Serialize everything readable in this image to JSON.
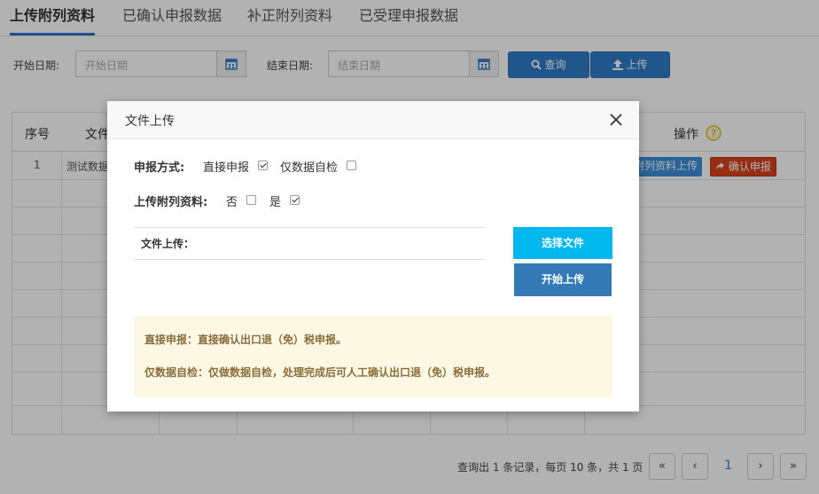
{
  "tabs": [
    "上传附列资料",
    "已确认申报数据",
    "补正附列资料",
    "已受理申报数据"
  ],
  "filter": {
    "start_label": "开始日期:",
    "start_placeholder": "开始日期",
    "end_label": "结束日期:",
    "end_placeholder": "结束日期",
    "query_button": "查询",
    "upload_button": "上传"
  },
  "table": {
    "headers": {
      "index": "序号",
      "file": "文件",
      "ops": "操作"
    },
    "row1": {
      "index": "1",
      "file": "测试数据"
    },
    "row_actions": {
      "attach_upload": "附列资料上传",
      "confirm": "确认申报"
    }
  },
  "pager": {
    "info": "查询出 1 条记录，每页 10 条，共 1 页",
    "first": "«",
    "prev": "‹",
    "current": "1",
    "next": "›",
    "last": "»"
  },
  "modal": {
    "title": "文件上传",
    "report_mode_label": "申报方式:",
    "direct_report": "直接申报",
    "direct_report_checked": true,
    "self_check_only": "仅数据自检",
    "self_check_only_checked": false,
    "attach_label": "上传附列资料:",
    "no_label": "否",
    "no_checked": false,
    "yes_label": "是",
    "yes_checked": true,
    "file_upload_label": "文件上传：",
    "choose_file": "选择文件",
    "start_upload": "开始上传",
    "notice_line1": "直接申报：直接确认出口退（免）税申报。",
    "notice_line2": "仅数据自检：仅做数据自检，处理完成后可人工确认出口退（免）税申报。"
  },
  "colors": {
    "primary": "#2e7cc9",
    "danger": "#d9431e",
    "select_file": "#00b7ee",
    "notice_bg": "#fcf8e3",
    "notice_text": "#8a6d3b"
  }
}
